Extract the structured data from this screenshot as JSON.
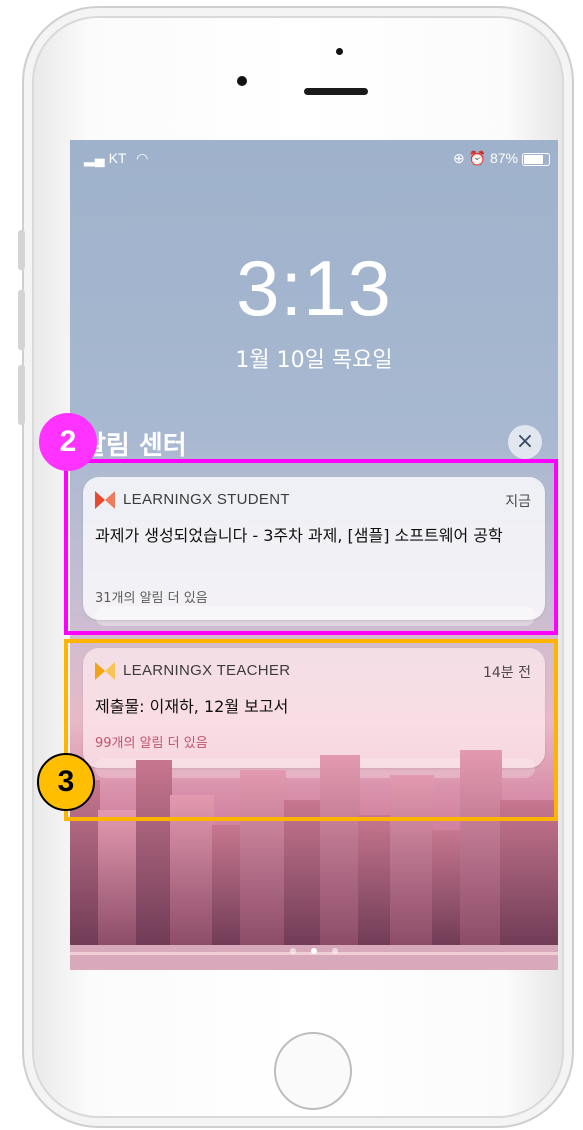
{
  "status_bar": {
    "carrier": "KT",
    "battery_text": "87%"
  },
  "lockscreen": {
    "time": "3:13",
    "date": "1월 10일 목요일"
  },
  "notification_center": {
    "title": "알림 센터",
    "close_symbol": "×",
    "notifications": [
      {
        "app": "LEARNINGX STUDENT",
        "when": "지금",
        "message": "과제가 생성되었습니다 - 3주차 과제, [샘플] 소프트웨어 공학",
        "more": "31개의 알림 더 있음",
        "icon_color": "#e8492f"
      },
      {
        "app": "LEARNINGX TEACHER",
        "when": "14분 전",
        "message": "제출물: 이재하, 12월 보고서",
        "more": "99개의 알림 더 있음",
        "icon_color": "#f2a316"
      }
    ]
  },
  "annotations": [
    {
      "label": "2",
      "color": "#ff00ff"
    },
    {
      "label": "3",
      "color": "#ffb400"
    }
  ],
  "page_dots": 3
}
